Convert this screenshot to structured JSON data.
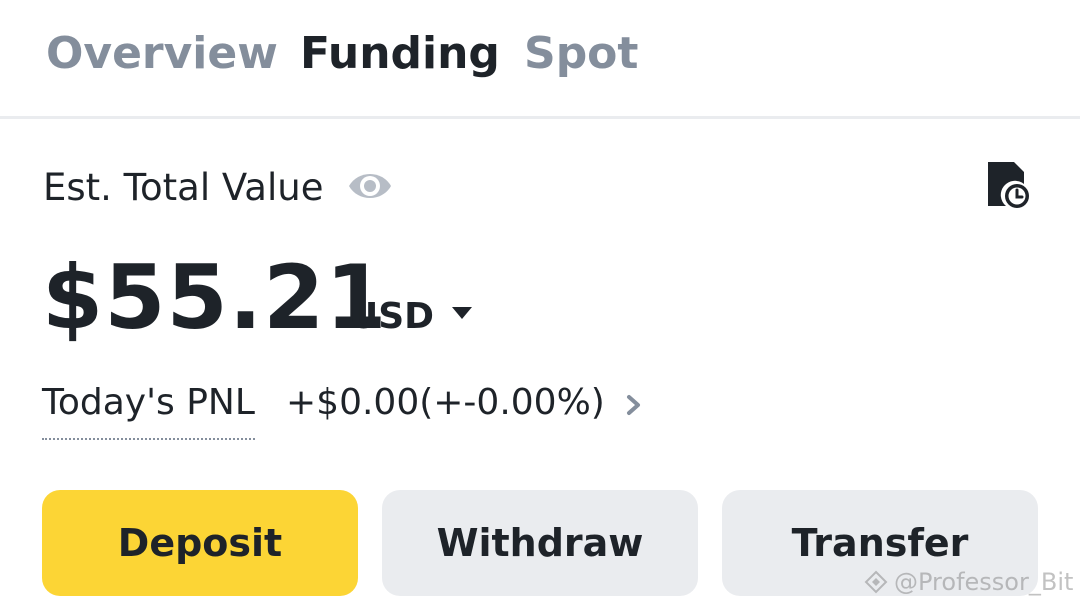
{
  "tabs": [
    {
      "label": "Overview",
      "active": false
    },
    {
      "label": "Funding",
      "active": true
    },
    {
      "label": "Spot",
      "active": false
    }
  ],
  "balance": {
    "label": "Est. Total Value",
    "amount": "$55.21",
    "currency": "USD",
    "visibility_icon": "eye-icon",
    "history_icon": "history-icon"
  },
  "pnl": {
    "label": "Today's PNL",
    "value": "+$0.00(+-0.00%)"
  },
  "actions": {
    "deposit_label": "Deposit",
    "withdraw_label": "Withdraw",
    "transfer_label": "Transfer"
  },
  "watermark": {
    "text": "@Professor_Bit"
  },
  "colors": {
    "primary": "#fcd535",
    "secondary_button": "#eaecef",
    "text": "#1e2329",
    "muted": "#848e9c"
  }
}
